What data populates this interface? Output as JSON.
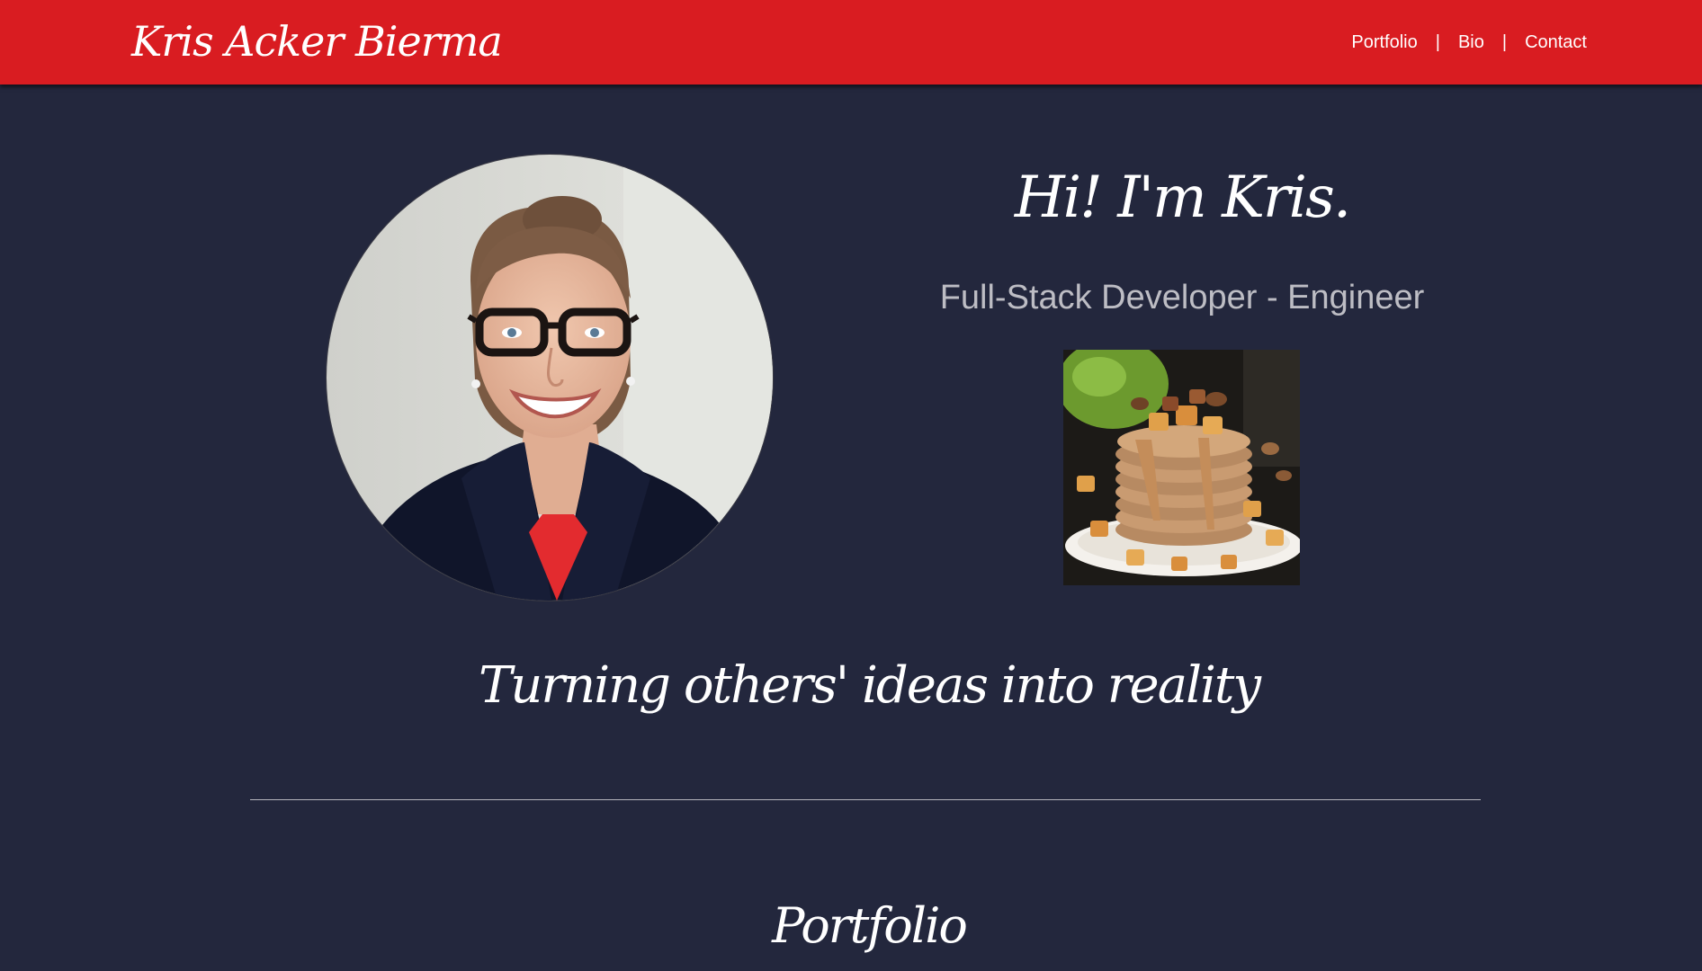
{
  "header": {
    "brand": "Kris Acker Bierma",
    "nav": [
      {
        "label": "Portfolio"
      },
      {
        "label": "Bio"
      },
      {
        "label": "Contact"
      }
    ],
    "separator": "|",
    "background": "#d91c21"
  },
  "hero": {
    "greeting": "Hi! I'm Kris.",
    "subtitle": "Full-Stack Developer - Engineer",
    "tagline": "Turning others' ideas into reality"
  },
  "sections": {
    "portfolio_title": "Portfolio"
  },
  "images": {
    "headshot": "headshot-photo",
    "food": "pancake-stack-photo"
  },
  "colors": {
    "page_background": "#23273d",
    "accent": "#d91c21",
    "text": "#ffffff",
    "subtitle_text": "#bdbdc4"
  }
}
